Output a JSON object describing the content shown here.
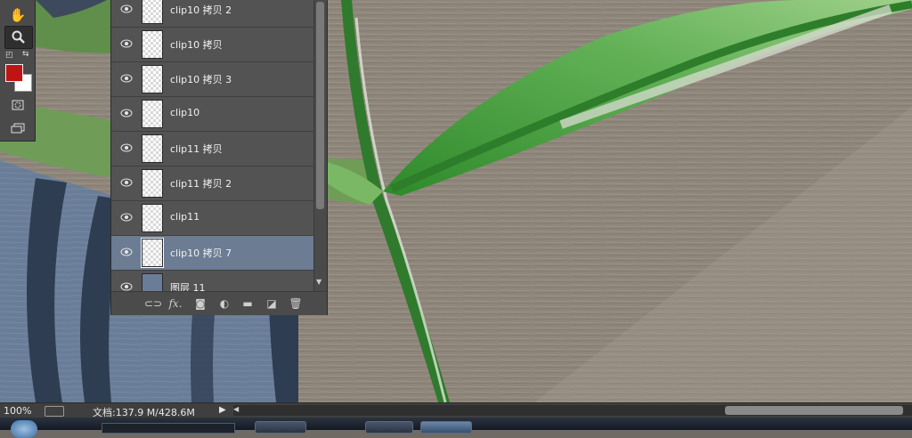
{
  "tools": {
    "items": [
      "hand-tool",
      "zoom-tool",
      "swap-colors",
      "quick-mask",
      "screen-mode"
    ],
    "foreground_color": "#c01414",
    "background_color": "#ffffff"
  },
  "layers": {
    "items": [
      {
        "name": "clip10 拷贝 2",
        "selected": false
      },
      {
        "name": "clip10 拷贝",
        "selected": false
      },
      {
        "name": "clip10 拷贝 3",
        "selected": false
      },
      {
        "name": "clip10",
        "selected": false
      },
      {
        "name": "clip11 拷贝",
        "selected": false
      },
      {
        "name": "clip11 拷贝 2",
        "selected": false
      },
      {
        "name": "clip11",
        "selected": false
      },
      {
        "name": "clip10 拷贝 7",
        "selected": true
      },
      {
        "name": "图层 11",
        "selected": false
      }
    ],
    "footer_icons": [
      "link-icon",
      "fx-icon",
      "mask-icon",
      "adjustment-icon",
      "folder-icon",
      "new-layer-icon",
      "trash-icon"
    ],
    "fx_label": "fx."
  },
  "status": {
    "zoom": "100%",
    "doc_info": "文档:137.9 M/428.6M",
    "arrow": "▶"
  },
  "canvas": {
    "colors": {
      "wood": "#8e857a",
      "leaf_dark": "#2f8a2e",
      "leaf_light": "#7ec06a",
      "grass": "#5f8f4a",
      "stripe_blue": "#2f3d52",
      "stripe_light": "#6b7d95"
    }
  }
}
